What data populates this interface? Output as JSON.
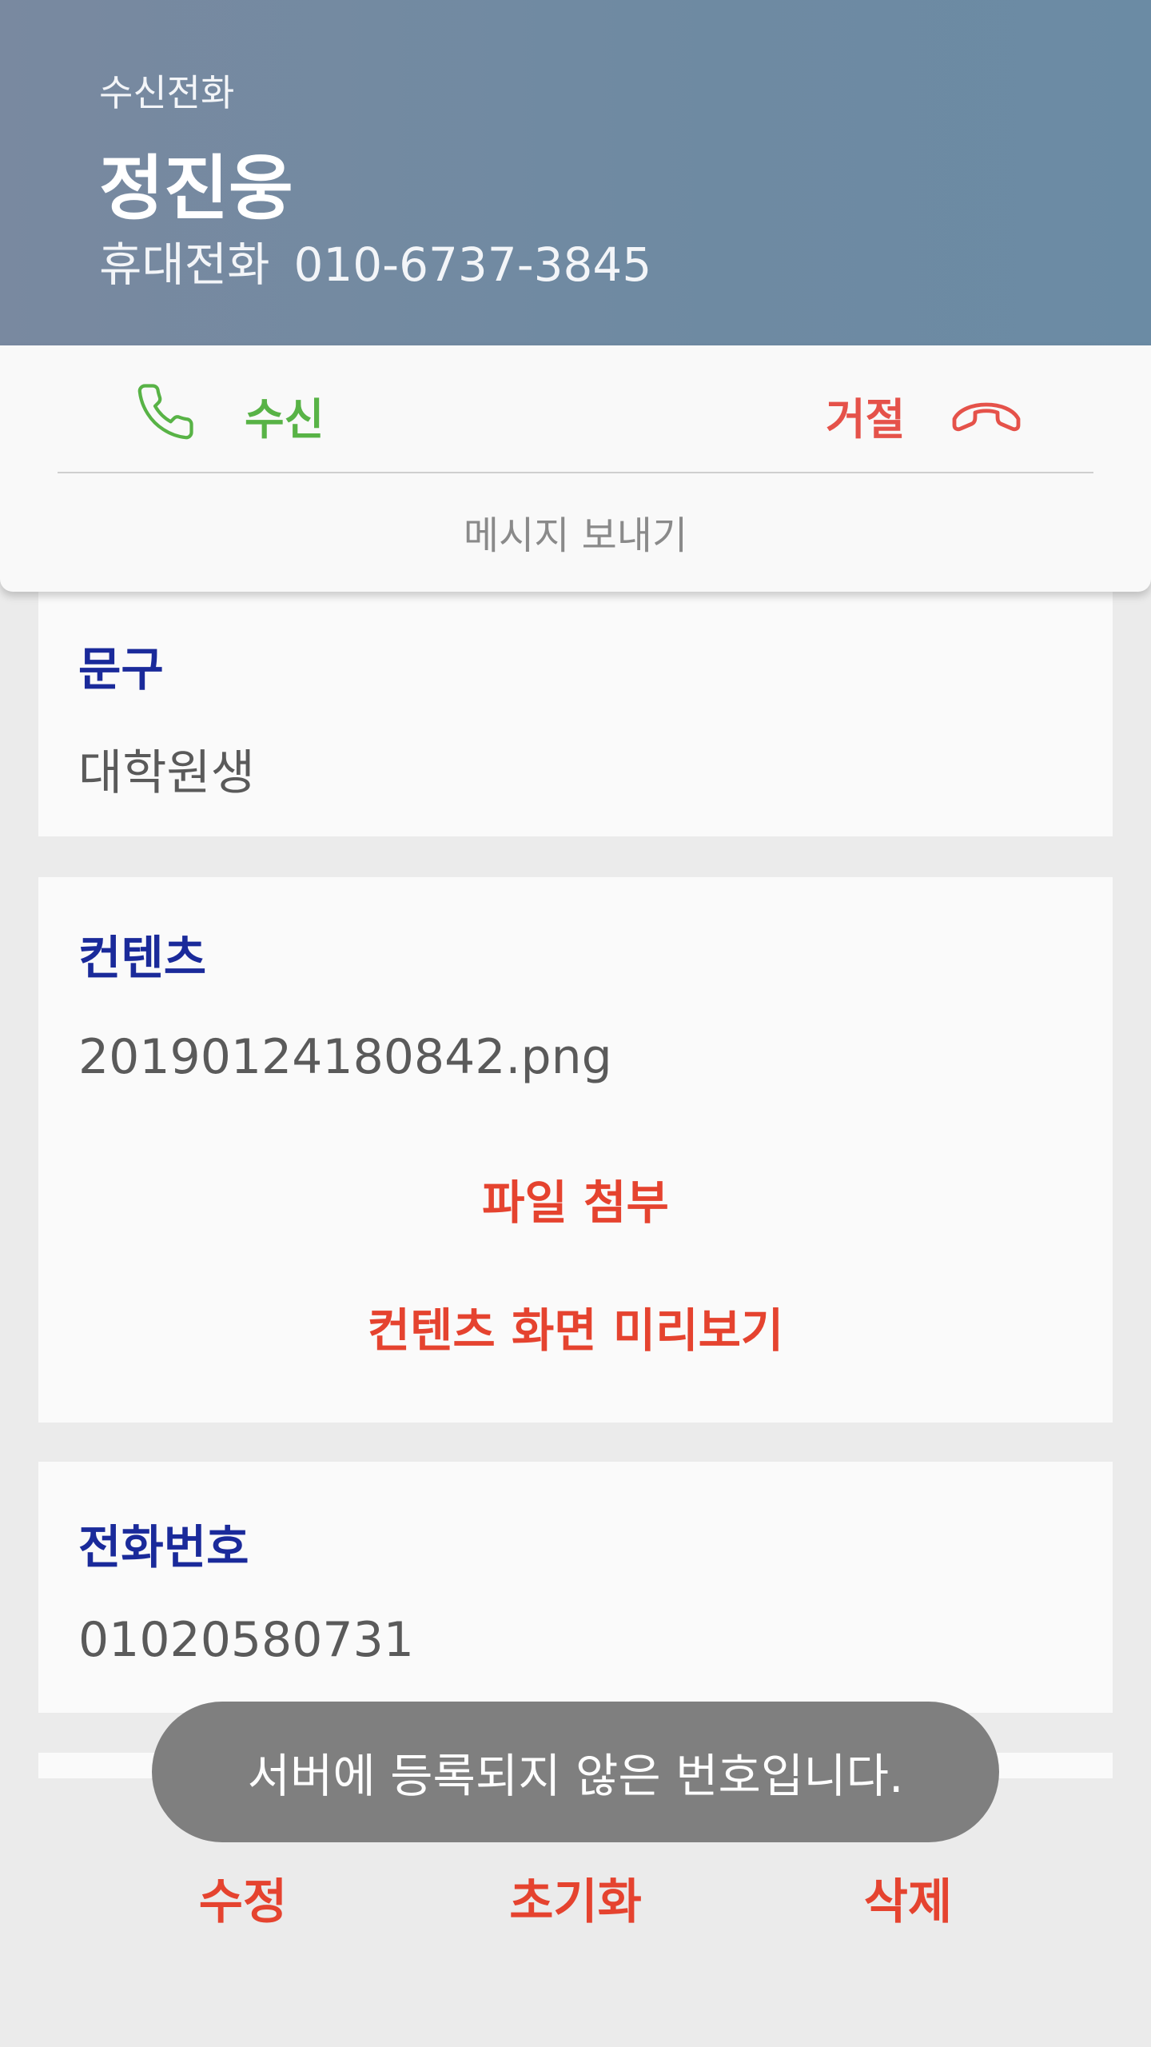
{
  "call": {
    "status": "수신전화",
    "caller_name": "정진웅",
    "phone_type": "휴대전화",
    "phone_number": "010-6737-3845",
    "accept_label": "수신",
    "reject_label": "거절",
    "send_message_label": "메시지 보내기",
    "accept_icon": "phone-icon",
    "reject_icon": "hang-up-icon",
    "colors": {
      "accept": "#58b346",
      "reject": "#e5524a",
      "header": "#6f8aa2"
    }
  },
  "phrase": {
    "title": "문구",
    "value": "대학원생"
  },
  "content": {
    "title": "컨텐츠",
    "filename": "20190124180842.png",
    "attach_label": "파일 첨부",
    "preview_label": "컨텐츠 화면 미리보기"
  },
  "phone": {
    "title": "전화번호",
    "value": "01020580731"
  },
  "toast": {
    "message": "서버에 등록되지 않은 번호입니다."
  },
  "actions": {
    "edit_label": "수정",
    "reset_label": "초기화",
    "delete_label": "삭제"
  },
  "colors": {
    "title": "#1a2a9a",
    "action": "#e5432f"
  }
}
